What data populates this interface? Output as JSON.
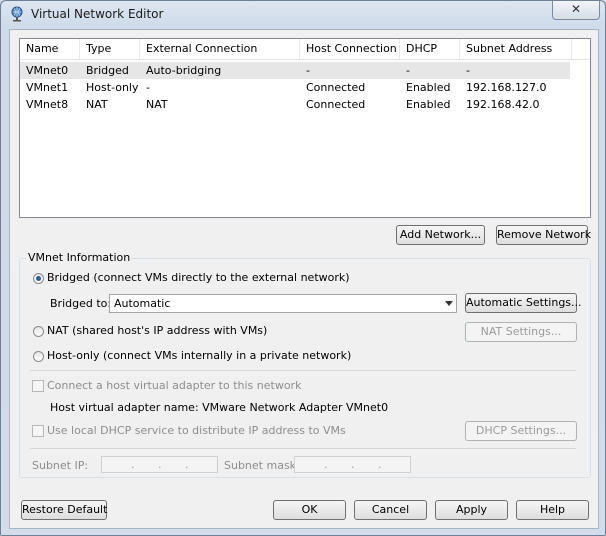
{
  "window": {
    "title": "Virtual Network Editor",
    "close_glyph": "✕"
  },
  "table": {
    "columns": [
      "Name",
      "Type",
      "External Connection",
      "Host Connection",
      "DHCP",
      "Subnet Address"
    ],
    "rows": [
      {
        "name": "VMnet0",
        "type": "Bridged",
        "external": "Auto-bridging",
        "host": "-",
        "dhcp": "-",
        "subnet": "-"
      },
      {
        "name": "VMnet1",
        "type": "Host-only",
        "external": "-",
        "host": "Connected",
        "dhcp": "Enabled",
        "subnet": "192.168.127.0"
      },
      {
        "name": "VMnet8",
        "type": "NAT",
        "external": "NAT",
        "host": "Connected",
        "dhcp": "Enabled",
        "subnet": "192.168.42.0"
      }
    ]
  },
  "buttons": {
    "add_network": "Add Network...",
    "remove_network": "Remove Network",
    "restore_default": "Restore Default",
    "ok": "OK",
    "cancel": "Cancel",
    "apply": "Apply",
    "help": "Help"
  },
  "vmnet_info": {
    "group_label": "VMnet Information",
    "bridged_label": "Bridged (connect VMs directly to the external network)",
    "bridged_to_label": "Bridged to:",
    "bridged_to_value": "Automatic",
    "automatic_settings": "Automatic Settings...",
    "nat_label": "NAT (shared host's IP address with VMs)",
    "nat_settings": "NAT Settings...",
    "hostonly_label": "Host-only (connect VMs internally in a private network)",
    "connect_adapter_label": "Connect a host virtual adapter to this network",
    "adapter_name_label": "Host virtual adapter name: VMware Network Adapter VMnet0",
    "dhcp_label": "Use local DHCP service to distribute IP address to VMs",
    "dhcp_settings": "DHCP Settings...",
    "subnet_ip_label": "Subnet IP:",
    "subnet_mask_label": "Subnet mask:",
    "selected_mode": "bridged"
  }
}
